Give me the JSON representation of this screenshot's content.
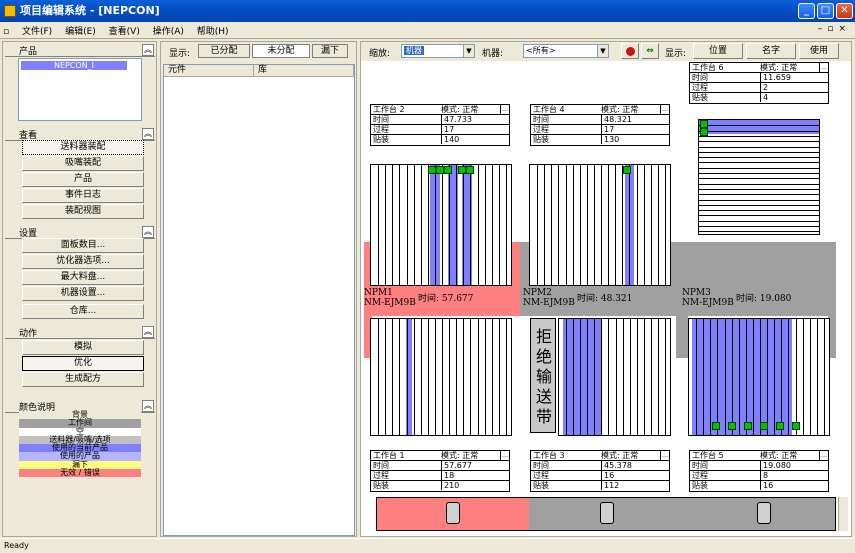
{
  "window": {
    "title": "项目编辑系统 - [NEPCON]"
  },
  "menu": [
    "文件(F)",
    "编辑(E)",
    "查看(V)",
    "操作(A)",
    "帮助(H)"
  ],
  "left": {
    "products_title": "产品",
    "selected_product": "NEPCON_I",
    "view_title": "查看",
    "view_items": [
      "送料器装配",
      "吸嘴装配",
      "产品",
      "事件日志",
      "装配视图"
    ],
    "settings_title": "设置",
    "settings_items": [
      "面板数目...",
      "优化器选项...",
      "最大料盘...",
      "机器设置...",
      "仓库..."
    ],
    "actions_title": "动作",
    "actions_items": [
      "模拟",
      "优化",
      "生成配方"
    ],
    "legend_title": "颜色说明",
    "legend": [
      {
        "label": "背景",
        "color": "#ece9d8"
      },
      {
        "label": "工作间",
        "color": "#a0a0a0"
      },
      {
        "label": "空",
        "color": "#ffffff"
      },
      {
        "label": "送料器/吸嘴/选项",
        "color": "#c0c0c0"
      },
      {
        "label": "使用的当前产品",
        "color": "#8080ff"
      },
      {
        "label": "使用的产品",
        "color": "#b4b4ff"
      },
      {
        "label": "漏下",
        "color": "#ffff80"
      },
      {
        "label": "无效 / 错误",
        "color": "#ff8080"
      }
    ]
  },
  "middle": {
    "show_label": "显示:",
    "tabs": [
      "已分配",
      "未分配",
      "漏下"
    ],
    "columns": [
      "元件",
      "库"
    ]
  },
  "right": {
    "zoom_label": "缩放:",
    "zoom_value": "机器",
    "machine_label": "机器:",
    "machine_value": "<所有>",
    "show_label": "显示:",
    "show_buttons": [
      "位置",
      "名字",
      "使用"
    ],
    "stations": [
      {
        "name": "工作台 6",
        "mode": "模式: 正常",
        "time": "11.659",
        "process": "2",
        "place": "4"
      },
      {
        "name": "工作台 2",
        "mode": "模式: 正常",
        "time": "47.733",
        "process": "17",
        "place": "140"
      },
      {
        "name": "工作台 4",
        "mode": "模式: 正常",
        "time": "48.321",
        "process": "17",
        "place": "130"
      },
      {
        "name": "工作台 1",
        "mode": "模式: 正常",
        "time": "57.677",
        "process": "18",
        "place": "210"
      },
      {
        "name": "工作台 3",
        "mode": "模式: 正常",
        "time": "45.378",
        "process": "16",
        "place": "112"
      },
      {
        "name": "工作台 5",
        "mode": "模式: 正常",
        "time": "19.080",
        "process": "8",
        "place": "16"
      }
    ],
    "row_labels": {
      "time": "时间",
      "process": "过程",
      "place": "贴装"
    },
    "machines": [
      {
        "name": "NPM1",
        "model": "NM-EJM9B",
        "time": "时间: 57.677"
      },
      {
        "name": "NPM2",
        "model": "NM-EJM9B",
        "time": "时间: 48.321"
      },
      {
        "name": "NPM3",
        "model": "NM-EJM9B",
        "time": "时间: 19.080"
      }
    ],
    "conveyor_text": "拒绝输送带"
  },
  "status": "Ready"
}
